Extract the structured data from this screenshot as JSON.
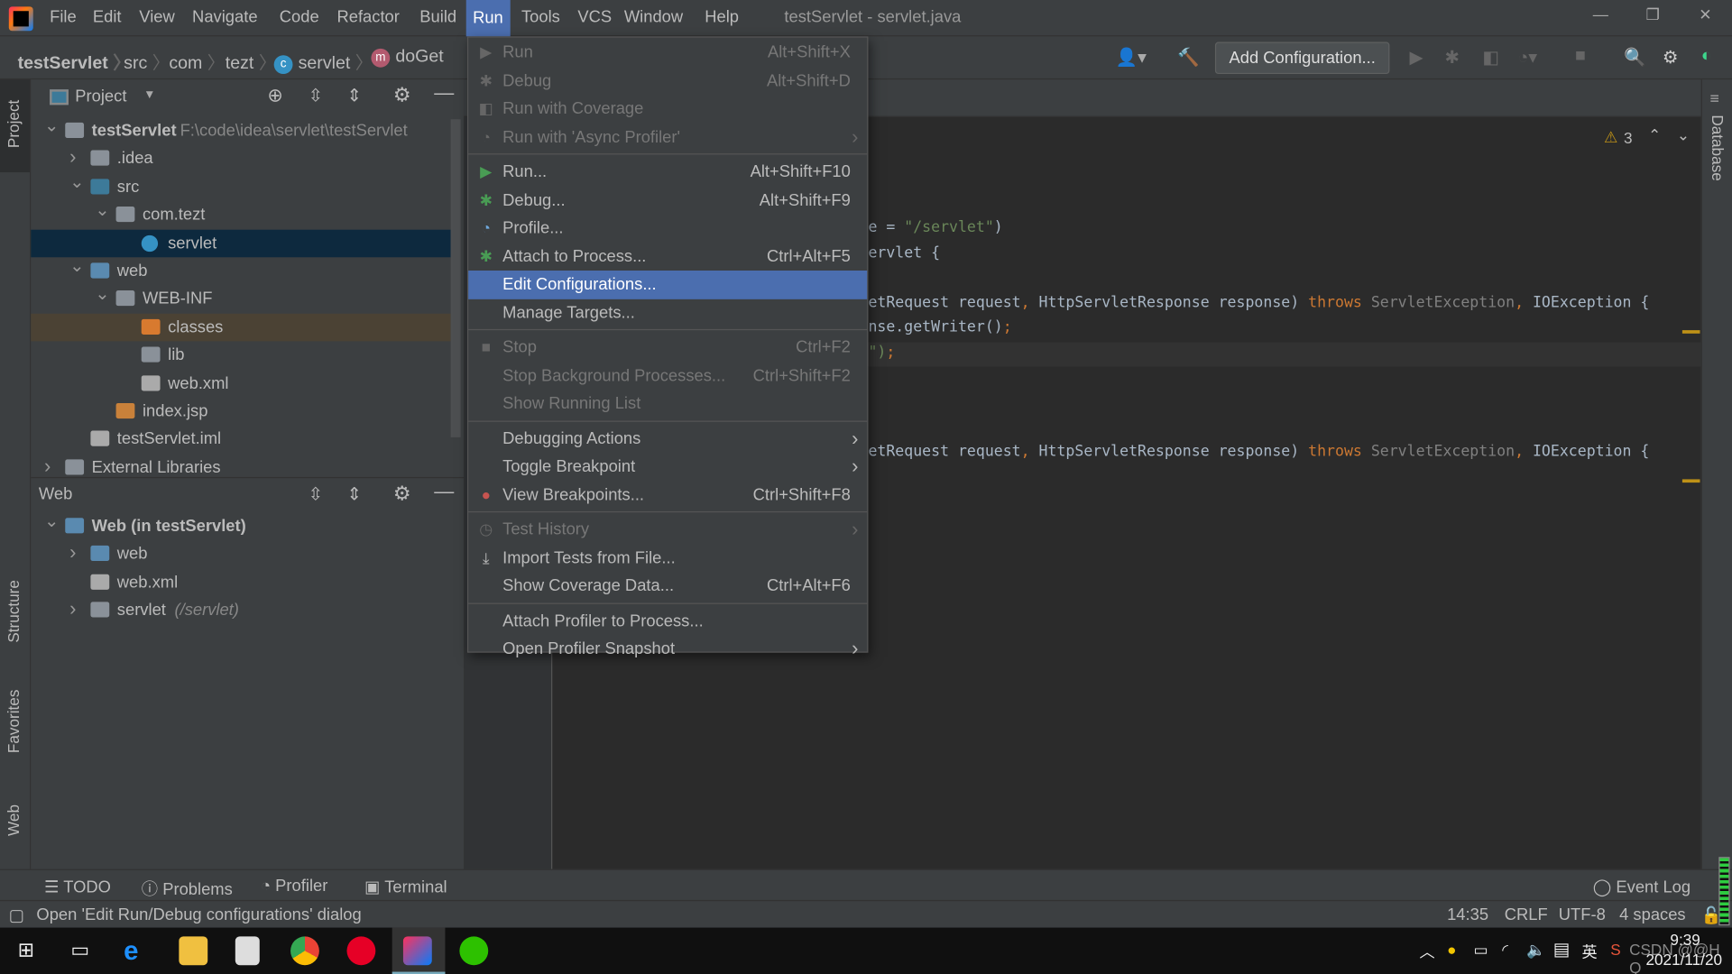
{
  "window": {
    "title": "testServlet - servlet.java",
    "controls": [
      "—",
      "❐",
      "✕"
    ]
  },
  "menubar": [
    "File",
    "Edit",
    "View",
    "Navigate",
    "Code",
    "Refactor",
    "Build",
    "Run",
    "Tools",
    "VCS",
    "Window",
    "Help"
  ],
  "breadcrumb": [
    {
      "label": "testServlet",
      "badge": ""
    },
    {
      "label": "src",
      "badge": ""
    },
    {
      "label": "com",
      "badge": ""
    },
    {
      "label": "tezt",
      "badge": ""
    },
    {
      "label": "servlet",
      "badge": "c"
    },
    {
      "label": "doGet",
      "badge": "m"
    }
  ],
  "toolbar": {
    "add_configuration": "Add Configuration..."
  },
  "left_stripe": [
    "Project",
    "Structure",
    "Favorites",
    "Web"
  ],
  "right_stripe": [
    "Database"
  ],
  "project_panel": {
    "title": "Project",
    "tree": [
      {
        "label": "testServlet",
        "hint": "F:\\code\\idea\\servlet\\testServlet"
      },
      {
        "label": ".idea"
      },
      {
        "label": "src"
      },
      {
        "label": "com.tezt"
      },
      {
        "label": "servlet"
      },
      {
        "label": "web"
      },
      {
        "label": "WEB-INF"
      },
      {
        "label": "classes"
      },
      {
        "label": "lib"
      },
      {
        "label": "web.xml"
      },
      {
        "label": "index.jsp"
      },
      {
        "label": "testServlet.iml"
      },
      {
        "label": "External Libraries"
      }
    ]
  },
  "web_panel": {
    "title": "Web",
    "tree": [
      {
        "label": "Web (in testServlet)"
      },
      {
        "label": "web"
      },
      {
        "label": "web.xml"
      },
      {
        "label": "servlet",
        "hint": "(/servlet)"
      }
    ]
  },
  "editor": {
    "warnings": "3",
    "lines": [
      [
        {
          "t": "e = ",
          "c": ""
        },
        {
          "t": "\"/servlet\"",
          "c": "str"
        },
        {
          "t": ")",
          "c": ""
        }
      ],
      [
        {
          "t": "ervlet {",
          "c": ""
        }
      ],
      [
        {
          "t": "etRequest request",
          "c": ""
        },
        {
          "t": ", ",
          "c": "kw"
        },
        {
          "t": "HttpServletResponse response) ",
          "c": ""
        },
        {
          "t": "throws ",
          "c": "kw"
        },
        {
          "t": "ServletException",
          "c": "gr"
        },
        {
          "t": ", ",
          "c": "kw"
        },
        {
          "t": "IOException {",
          "c": ""
        }
      ],
      [
        {
          "t": "nse.getWriter()",
          "c": ""
        },
        {
          "t": ";",
          "c": "kw"
        }
      ],
      [
        {
          "t": "\")",
          "c": "str"
        },
        {
          "t": ";",
          "c": "kw"
        }
      ],
      [
        {
          "t": "etRequest request",
          "c": ""
        },
        {
          "t": ", ",
          "c": "kw"
        },
        {
          "t": "HttpServletResponse response) ",
          "c": ""
        },
        {
          "t": "throws ",
          "c": "kw"
        },
        {
          "t": "ServletException",
          "c": "gr"
        },
        {
          "t": ", ",
          "c": "kw"
        },
        {
          "t": "IOException {",
          "c": ""
        }
      ]
    ]
  },
  "run_menu": [
    {
      "label": "Run",
      "shortcut": "Alt+Shift+X",
      "icon": "run-icon",
      "disabled": true
    },
    {
      "label": "Debug",
      "shortcut": "Alt+Shift+D",
      "icon": "debug-icon",
      "disabled": true
    },
    {
      "label": "Run with Coverage",
      "shortcut": "",
      "icon": "coverage-icon",
      "disabled": true
    },
    {
      "label": "Run with 'Async Profiler'",
      "shortcut": "",
      "icon": "profiler-icon",
      "disabled": true,
      "submenu": true
    },
    {
      "sep": true
    },
    {
      "label": "Run...",
      "shortcut": "Alt+Shift+F10",
      "icon": "run-icon"
    },
    {
      "label": "Debug...",
      "shortcut": "Alt+Shift+F9",
      "icon": "debug-icon"
    },
    {
      "label": "Profile...",
      "shortcut": "",
      "icon": "profile-icon"
    },
    {
      "label": "Attach to Process...",
      "shortcut": "Ctrl+Alt+F5",
      "icon": "attach-icon"
    },
    {
      "label": "Edit Configurations...",
      "shortcut": "",
      "icon": "",
      "highlighted": true
    },
    {
      "label": "Manage Targets...",
      "shortcut": "",
      "icon": ""
    },
    {
      "sep": true
    },
    {
      "label": "Stop",
      "shortcut": "Ctrl+F2",
      "icon": "stop-icon",
      "disabled": true
    },
    {
      "label": "Stop Background Processes...",
      "shortcut": "Ctrl+Shift+F2",
      "icon": "",
      "disabled": true
    },
    {
      "label": "Show Running List",
      "shortcut": "",
      "icon": "",
      "disabled": true
    },
    {
      "sep": true
    },
    {
      "label": "Debugging Actions",
      "shortcut": "",
      "icon": "",
      "submenu": true
    },
    {
      "label": "Toggle Breakpoint",
      "shortcut": "",
      "icon": "",
      "submenu": true
    },
    {
      "label": "View Breakpoints...",
      "shortcut": "Ctrl+Shift+F8",
      "icon": "breakpoints-icon"
    },
    {
      "sep": true
    },
    {
      "label": "Test History",
      "shortcut": "",
      "icon": "history-icon",
      "disabled": true,
      "submenu": true
    },
    {
      "label": "Import Tests from File...",
      "shortcut": "",
      "icon": "import-icon"
    },
    {
      "label": "Show Coverage Data...",
      "shortcut": "Ctrl+Alt+F6",
      "icon": ""
    },
    {
      "sep": true
    },
    {
      "label": "Attach Profiler to Process...",
      "shortcut": "",
      "icon": ""
    },
    {
      "label": "Open Profiler Snapshot",
      "shortcut": "",
      "icon": "",
      "submenu": true
    }
  ],
  "bottom_tabs": [
    "TODO",
    "Problems",
    "Profiler",
    "Terminal"
  ],
  "event_log": "Event Log",
  "status": {
    "message": "Open 'Edit Run/Debug configurations' dialog",
    "position": "14:35",
    "line_sep": "CRLF",
    "encoding": "UTF-8",
    "indent": "4 spaces"
  },
  "taskbar": {
    "time": "9:39",
    "date": "2021/11/20",
    "ime": "英",
    "watermark": "CSDN @@H Q"
  },
  "colors": {
    "accent": "#4b6eaf",
    "selection": "#0d293e",
    "editor_bg": "#2b2b2b",
    "panel_bg": "#3c3f41"
  }
}
